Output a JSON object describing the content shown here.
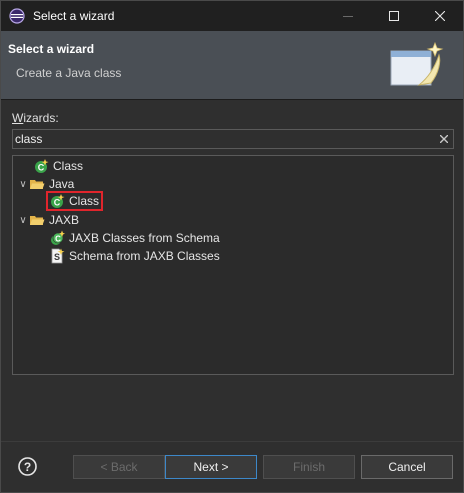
{
  "window": {
    "title": "Select a wizard"
  },
  "banner": {
    "title": "Select a wizard",
    "subtitle": "Create a Java class"
  },
  "wizards": {
    "label_prefix": "W",
    "label_rest": "izards:",
    "search_value": "class"
  },
  "tree": {
    "root_class": "Class",
    "java": {
      "label": "Java",
      "child": "Class"
    },
    "jaxb": {
      "label": "JAXB",
      "children": [
        "JAXB Classes from Schema",
        "Schema from JAXB Classes"
      ]
    }
  },
  "buttons": {
    "back": "< Back",
    "next": "Next >",
    "finish": "Finish",
    "cancel": "Cancel"
  },
  "colors": {
    "selection_outline": "#e0252c",
    "default_button_border": "#3d88c9"
  }
}
